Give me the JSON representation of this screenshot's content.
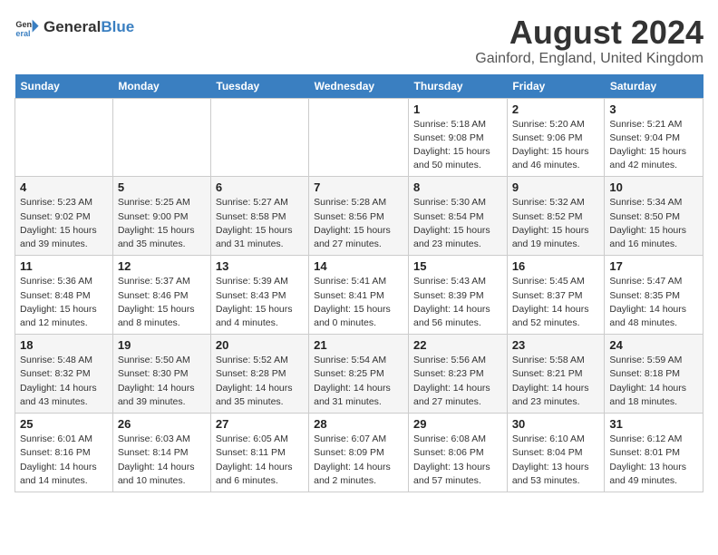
{
  "header": {
    "logo_general": "General",
    "logo_blue": "Blue",
    "title": "August 2024",
    "subtitle": "Gainford, England, United Kingdom"
  },
  "days_of_week": [
    "Sunday",
    "Monday",
    "Tuesday",
    "Wednesday",
    "Thursday",
    "Friday",
    "Saturday"
  ],
  "weeks": [
    [
      {
        "day": "",
        "info": ""
      },
      {
        "day": "",
        "info": ""
      },
      {
        "day": "",
        "info": ""
      },
      {
        "day": "",
        "info": ""
      },
      {
        "day": "1",
        "info": "Sunrise: 5:18 AM\nSunset: 9:08 PM\nDaylight: 15 hours\nand 50 minutes."
      },
      {
        "day": "2",
        "info": "Sunrise: 5:20 AM\nSunset: 9:06 PM\nDaylight: 15 hours\nand 46 minutes."
      },
      {
        "day": "3",
        "info": "Sunrise: 5:21 AM\nSunset: 9:04 PM\nDaylight: 15 hours\nand 42 minutes."
      }
    ],
    [
      {
        "day": "4",
        "info": "Sunrise: 5:23 AM\nSunset: 9:02 PM\nDaylight: 15 hours\nand 39 minutes."
      },
      {
        "day": "5",
        "info": "Sunrise: 5:25 AM\nSunset: 9:00 PM\nDaylight: 15 hours\nand 35 minutes."
      },
      {
        "day": "6",
        "info": "Sunrise: 5:27 AM\nSunset: 8:58 PM\nDaylight: 15 hours\nand 31 minutes."
      },
      {
        "day": "7",
        "info": "Sunrise: 5:28 AM\nSunset: 8:56 PM\nDaylight: 15 hours\nand 27 minutes."
      },
      {
        "day": "8",
        "info": "Sunrise: 5:30 AM\nSunset: 8:54 PM\nDaylight: 15 hours\nand 23 minutes."
      },
      {
        "day": "9",
        "info": "Sunrise: 5:32 AM\nSunset: 8:52 PM\nDaylight: 15 hours\nand 19 minutes."
      },
      {
        "day": "10",
        "info": "Sunrise: 5:34 AM\nSunset: 8:50 PM\nDaylight: 15 hours\nand 16 minutes."
      }
    ],
    [
      {
        "day": "11",
        "info": "Sunrise: 5:36 AM\nSunset: 8:48 PM\nDaylight: 15 hours\nand 12 minutes."
      },
      {
        "day": "12",
        "info": "Sunrise: 5:37 AM\nSunset: 8:46 PM\nDaylight: 15 hours\nand 8 minutes."
      },
      {
        "day": "13",
        "info": "Sunrise: 5:39 AM\nSunset: 8:43 PM\nDaylight: 15 hours\nand 4 minutes."
      },
      {
        "day": "14",
        "info": "Sunrise: 5:41 AM\nSunset: 8:41 PM\nDaylight: 15 hours\nand 0 minutes."
      },
      {
        "day": "15",
        "info": "Sunrise: 5:43 AM\nSunset: 8:39 PM\nDaylight: 14 hours\nand 56 minutes."
      },
      {
        "day": "16",
        "info": "Sunrise: 5:45 AM\nSunset: 8:37 PM\nDaylight: 14 hours\nand 52 minutes."
      },
      {
        "day": "17",
        "info": "Sunrise: 5:47 AM\nSunset: 8:35 PM\nDaylight: 14 hours\nand 48 minutes."
      }
    ],
    [
      {
        "day": "18",
        "info": "Sunrise: 5:48 AM\nSunset: 8:32 PM\nDaylight: 14 hours\nand 43 minutes."
      },
      {
        "day": "19",
        "info": "Sunrise: 5:50 AM\nSunset: 8:30 PM\nDaylight: 14 hours\nand 39 minutes."
      },
      {
        "day": "20",
        "info": "Sunrise: 5:52 AM\nSunset: 8:28 PM\nDaylight: 14 hours\nand 35 minutes."
      },
      {
        "day": "21",
        "info": "Sunrise: 5:54 AM\nSunset: 8:25 PM\nDaylight: 14 hours\nand 31 minutes."
      },
      {
        "day": "22",
        "info": "Sunrise: 5:56 AM\nSunset: 8:23 PM\nDaylight: 14 hours\nand 27 minutes."
      },
      {
        "day": "23",
        "info": "Sunrise: 5:58 AM\nSunset: 8:21 PM\nDaylight: 14 hours\nand 23 minutes."
      },
      {
        "day": "24",
        "info": "Sunrise: 5:59 AM\nSunset: 8:18 PM\nDaylight: 14 hours\nand 18 minutes."
      }
    ],
    [
      {
        "day": "25",
        "info": "Sunrise: 6:01 AM\nSunset: 8:16 PM\nDaylight: 14 hours\nand 14 minutes."
      },
      {
        "day": "26",
        "info": "Sunrise: 6:03 AM\nSunset: 8:14 PM\nDaylight: 14 hours\nand 10 minutes."
      },
      {
        "day": "27",
        "info": "Sunrise: 6:05 AM\nSunset: 8:11 PM\nDaylight: 14 hours\nand 6 minutes."
      },
      {
        "day": "28",
        "info": "Sunrise: 6:07 AM\nSunset: 8:09 PM\nDaylight: 14 hours\nand 2 minutes."
      },
      {
        "day": "29",
        "info": "Sunrise: 6:08 AM\nSunset: 8:06 PM\nDaylight: 13 hours\nand 57 minutes."
      },
      {
        "day": "30",
        "info": "Sunrise: 6:10 AM\nSunset: 8:04 PM\nDaylight: 13 hours\nand 53 minutes."
      },
      {
        "day": "31",
        "info": "Sunrise: 6:12 AM\nSunset: 8:01 PM\nDaylight: 13 hours\nand 49 minutes."
      }
    ]
  ]
}
